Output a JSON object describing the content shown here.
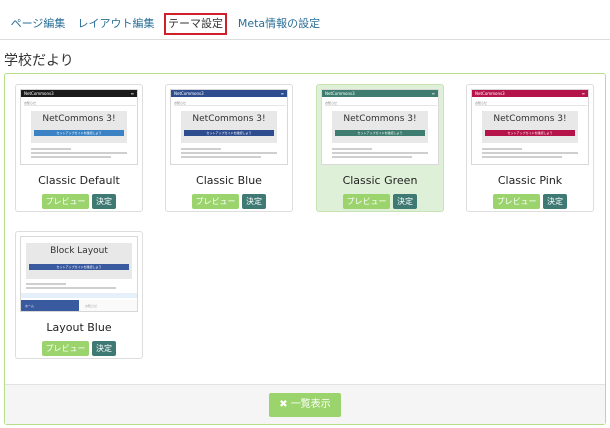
{
  "tabs": [
    {
      "label": "ページ編集"
    },
    {
      "label": "レイアウト編集"
    },
    {
      "label": "テーマ設定"
    },
    {
      "label": "Meta情報の設定"
    }
  ],
  "page_title": "学校だより",
  "button_labels": {
    "preview": "プレビュー",
    "apply": "決定"
  },
  "themes": [
    {
      "name": "Classic Default",
      "selected": false,
      "bar_color": "#1a1a1a",
      "strip_color": "#3a82c4",
      "thumb": {
        "site": "NetCommons3",
        "crumb": "お知らせ",
        "headline": "NetCommons 3!",
        "strip_text": "セットアップガイドを確認しよう"
      }
    },
    {
      "name": "Classic Blue",
      "selected": false,
      "bar_color": "#2e4d8f",
      "strip_color": "#2e4d8f",
      "thumb": {
        "site": "NetCommons3",
        "crumb": "お知らせ",
        "headline": "NetCommons 3!",
        "strip_text": "セットアップガイドを確認しよう"
      }
    },
    {
      "name": "Classic Green",
      "selected": true,
      "bar_color": "#3d7c6e",
      "strip_color": "#3d7c6e",
      "thumb": {
        "site": "NetCommons3",
        "crumb": "お知らせ",
        "headline": "NetCommons 3!",
        "strip_text": "セットアップガイドを確認しよう"
      }
    },
    {
      "name": "Classic Pink",
      "selected": false,
      "bar_color": "#b5144b",
      "strip_color": "#b5144b",
      "thumb": {
        "site": "NetCommons3",
        "crumb": "お知らせ",
        "headline": "NetCommons 3!",
        "strip_text": "セットアップガイドを確認しよう"
      }
    }
  ],
  "block_theme": {
    "name": "Layout Blue",
    "selected": false,
    "thumb": {
      "headline": "Block Layout",
      "strip_text": "セットアップガイドを確認しよう",
      "left_text": "ホーム",
      "right_text": "お知らせ"
    }
  },
  "footer": {
    "list_button": "一覧表示"
  },
  "colors": {
    "accent_green": "#9bd46c",
    "apply_teal": "#3e7a73",
    "tab_highlight": "#d0202a",
    "selected_card": "#dff0d8"
  }
}
